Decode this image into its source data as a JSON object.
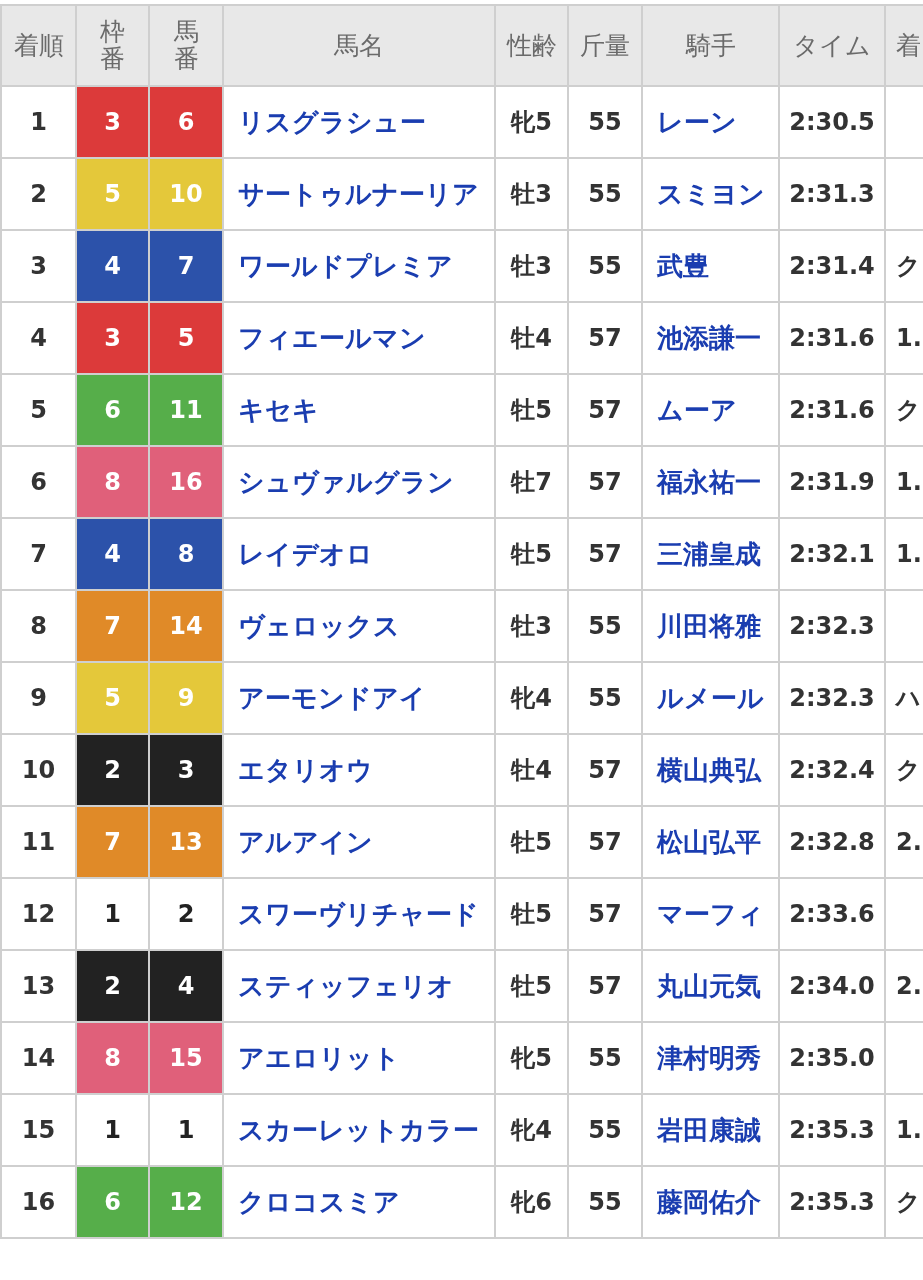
{
  "table": {
    "columns": [
      "着順",
      "枠番",
      "馬番",
      "馬名",
      "性齢",
      "斤量",
      "騎手",
      "タイム",
      "着"
    ],
    "rows": [
      {
        "rank": "1",
        "frame": "3",
        "number": "6",
        "color": "#dc3a3a",
        "horse": "リスグラシュー",
        "sex_age": "牝5",
        "weight": "55",
        "jockey": "レーン",
        "time": "2:30.5",
        "column_9": ""
      },
      {
        "rank": "2",
        "frame": "5",
        "number": "10",
        "color": "#e4c83a",
        "horse": "サートゥルナーリア",
        "sex_age": "牡3",
        "weight": "55",
        "jockey": "スミヨン",
        "time": "2:31.3",
        "column_9": ""
      },
      {
        "rank": "3",
        "frame": "4",
        "number": "7",
        "color": "#2c52aa",
        "horse": "ワールドプレミア",
        "sex_age": "牡3",
        "weight": "55",
        "jockey": "武豊",
        "time": "2:31.4",
        "column_9": "ク"
      },
      {
        "rank": "4",
        "frame": "3",
        "number": "5",
        "color": "#dc3a3a",
        "horse": "フィエールマン",
        "sex_age": "牡4",
        "weight": "57",
        "jockey": "池添謙一",
        "time": "2:31.6",
        "column_9": "1."
      },
      {
        "rank": "5",
        "frame": "6",
        "number": "11",
        "color": "#56ae4a",
        "horse": "キセキ",
        "sex_age": "牡5",
        "weight": "57",
        "jockey": "ムーア",
        "time": "2:31.6",
        "column_9": "ク"
      },
      {
        "rank": "6",
        "frame": "8",
        "number": "16",
        "color": "#e0607a",
        "horse": "シュヴァルグラン",
        "sex_age": "牡7",
        "weight": "57",
        "jockey": "福永祐一",
        "time": "2:31.9",
        "column_9": "1."
      },
      {
        "rank": "7",
        "frame": "4",
        "number": "8",
        "color": "#2c52aa",
        "horse": "レイデオロ",
        "sex_age": "牡5",
        "weight": "57",
        "jockey": "三浦皇成",
        "time": "2:32.1",
        "column_9": "1."
      },
      {
        "rank": "8",
        "frame": "7",
        "number": "14",
        "color": "#e08a28",
        "horse": "ヴェロックス",
        "sex_age": "牡3",
        "weight": "55",
        "jockey": "川田将雅",
        "time": "2:32.3",
        "column_9": ""
      },
      {
        "rank": "9",
        "frame": "5",
        "number": "9",
        "color": "#e4c83a",
        "horse": "アーモンドアイ",
        "sex_age": "牝4",
        "weight": "55",
        "jockey": "ルメール",
        "time": "2:32.3",
        "column_9": "ハ"
      },
      {
        "rank": "10",
        "frame": "2",
        "number": "3",
        "color": "#222222",
        "horse": "エタリオウ",
        "sex_age": "牡4",
        "weight": "57",
        "jockey": "横山典弘",
        "time": "2:32.4",
        "column_9": "ク"
      },
      {
        "rank": "11",
        "frame": "7",
        "number": "13",
        "color": "#e08a28",
        "horse": "アルアイン",
        "sex_age": "牡5",
        "weight": "57",
        "jockey": "松山弘平",
        "time": "2:32.8",
        "column_9": "2."
      },
      {
        "rank": "12",
        "frame": "1",
        "number": "2",
        "color": "#ffffff",
        "horse": "スワーヴリチャード",
        "sex_age": "牡5",
        "weight": "57",
        "jockey": "マーフィ",
        "time": "2:33.6",
        "column_9": ""
      },
      {
        "rank": "13",
        "frame": "2",
        "number": "4",
        "color": "#222222",
        "horse": "スティッフェリオ",
        "sex_age": "牡5",
        "weight": "57",
        "jockey": "丸山元気",
        "time": "2:34.0",
        "column_9": "2."
      },
      {
        "rank": "14",
        "frame": "8",
        "number": "15",
        "color": "#e0607a",
        "horse": "アエロリット",
        "sex_age": "牝5",
        "weight": "55",
        "jockey": "津村明秀",
        "time": "2:35.0",
        "column_9": ""
      },
      {
        "rank": "15",
        "frame": "1",
        "number": "1",
        "color": "#ffffff",
        "horse": "スカーレットカラー",
        "sex_age": "牝4",
        "weight": "55",
        "jockey": "岩田康誠",
        "time": "2:35.3",
        "column_9": "1."
      },
      {
        "rank": "16",
        "frame": "6",
        "number": "12",
        "color": "#56ae4a",
        "horse": "クロコスミア",
        "sex_age": "牝6",
        "weight": "55",
        "jockey": "藤岡佑介",
        "time": "2:35.3",
        "column_9": "ク"
      }
    ]
  }
}
